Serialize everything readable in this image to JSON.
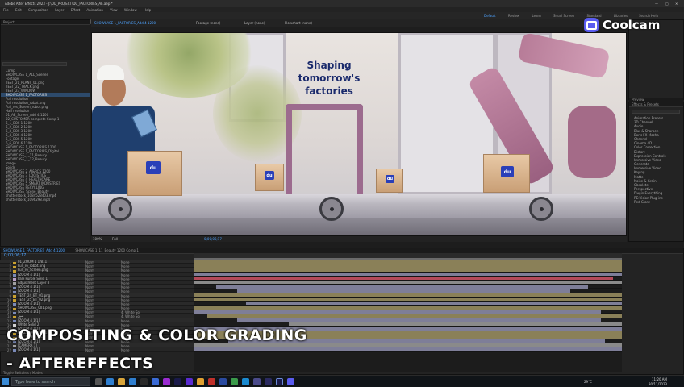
{
  "app": {
    "title": "Adobe After Effects 2023 - J:\\DU_PROJECT\\DU_FACTORIES_AE.aep *",
    "menu": [
      "File",
      "Edit",
      "Composition",
      "Layer",
      "Effect",
      "Animation",
      "View",
      "Window",
      "Help"
    ],
    "workspaces": [
      "Default",
      "Review",
      "Learn",
      "Small Screen",
      "Standard",
      "Libraries"
    ],
    "active_workspace": "Default",
    "search_label": "Search Help"
  },
  "watermark": {
    "brand": "Coolcam"
  },
  "captions": {
    "line1": "COMPOSITING & COLOR GRADING",
    "line2": "- AFTEREFFECTS"
  },
  "project_panel": {
    "tab": "Project",
    "items": [
      "Comp",
      "SHOWCASE 1_ALL_Scenes",
      "Footage",
      "TEST_21_PLANT_01.png",
      "TEST_22_TRACK.png",
      "TEST_23_WINDOW",
      "SHOWCASE 1_FACTORIES",
      "Full resolution",
      "Full resolution_robot.png",
      "Full_res_Screen_robot.png",
      "Half resolution",
      "01_AE_Screen_Add 4 1200",
      "02_CUSTOMER complete Comp 1",
      "6_1_BOX 1 1200",
      "6_2_BOX 2 1200",
      "6_3_BOX 3 1200",
      "6_4_BOX 4 1200",
      "6_5_BOX 5 1200",
      "6_6_BOX 6 1200",
      "SHOWCASE 1_FACTORIES 1200",
      "SHOWCASE 1_FACTORIES_Digital",
      "SHOWCASE_1_11_Beauty",
      "SHOWCASE_1_12_Beauty",
      "Image",
      "Solids",
      "SHOWCASE 2_AI&RCS 1200",
      "SHOWCASE 3_LOGISTICS",
      "SHOWCASE 4_HEALTHCARE",
      "SHOWCASE 5_SMART INDUSTRIES",
      "SHOWCASE RECYCLING",
      "SHOWCASE_Scene_Beauty",
      "shutterstock_1084528403.mp4",
      "shutterstock_1096298.mp4"
    ],
    "selected_index": 6
  },
  "composition_tabs": {
    "active": "SHOWCASE 1_FACTORIES_Add 4 1200",
    "others": [
      "Footage (none)",
      "Layer (none)",
      "Flowchart (none)"
    ]
  },
  "viewer": {
    "headline_line1": "Shaping",
    "headline_line2": "tomorrow's factories",
    "box_logo": "du",
    "zoom": "100%",
    "resolution": "Full",
    "timecode": "0;00;06;17"
  },
  "right_panels": {
    "preview_tab": "Preview",
    "effects_tab": "Effects & Presets",
    "effects": [
      "Animation Presets",
      "3D Channel",
      "Audio",
      "Blur & Sharpen",
      "Boris FX Mocha",
      "Channel",
      "Cinema 4D",
      "Color Correction",
      "Distort",
      "Expression Controls",
      "Immersive Video",
      "Generate",
      "Immersive Video",
      "Keying",
      "Matte",
      "Noise & Grain",
      "Obsolete",
      "Perspective",
      "Plugin Everything",
      "RE:Vision Plug-ins",
      "Red Giant"
    ]
  },
  "timeline": {
    "tabs": [
      "SHOWCASE 1_FACTORIES_Add 4 1200",
      "SHOWCASE 1_11_Beauty 1200 Comp 1"
    ],
    "current_time": "0;00;06;17",
    "columns": [
      "#",
      "Source Name",
      "Mode",
      "Track Matte",
      "Parent & Link"
    ],
    "layers": [
      {
        "num": "1",
        "name": "01_ZOOM 1 1/811",
        "color": "#c8a030",
        "mode": "Norm",
        "parent": "None"
      },
      {
        "num": "2",
        "name": "Full_ro_robot.png",
        "color": "#c8a030",
        "mode": "Norm",
        "parent": "None"
      },
      {
        "num": "3",
        "name": "Full_ro_Screen.png",
        "color": "#c8a030",
        "mode": "Norm",
        "parent": "None"
      },
      {
        "num": "4",
        "name": "[ZOOM 4 1/1]",
        "color": "#7a8ab8",
        "mode": "Norm",
        "parent": "None"
      },
      {
        "num": "5",
        "name": "Pale Purple Solid 1",
        "color": "#b8a0c8",
        "mode": "Norm",
        "parent": "None"
      },
      {
        "num": "6",
        "name": "Adjustment Layer 8",
        "color": "#a0a0a0",
        "mode": "Norm",
        "parent": "None"
      },
      {
        "num": "7",
        "name": "[ZOOM 4 1/1]",
        "color": "#7a8ab8",
        "mode": "Norm",
        "parent": "None"
      },
      {
        "num": "8",
        "name": "[ZOOM 4 1/1]",
        "color": "#7a8ab8",
        "mode": "Norm",
        "parent": "None"
      },
      {
        "num": "9",
        "name": "TEST_24_BT_01.png",
        "color": "#c8a030",
        "mode": "Norm",
        "parent": "None"
      },
      {
        "num": "10",
        "name": "TEST_25_BT_02.png",
        "color": "#c8a030",
        "mode": "Norm",
        "parent": "None"
      },
      {
        "num": "11",
        "name": "[ZOOM 4 1/1]",
        "color": "#7a8ab8",
        "mode": "Norm",
        "parent": "None"
      },
      {
        "num": "12",
        "name": "SHOWCASE_001.png",
        "color": "#c8a030",
        "mode": "Norm",
        "parent": "None"
      },
      {
        "num": "13",
        "name": "[ZOOM 4 1/1]",
        "color": "#7a8ab8",
        "mode": "Norm",
        "parent": "4. White Sol"
      },
      {
        "num": "14",
        "name": "صور",
        "color": "#c8a030",
        "mode": "Norm",
        "parent": "4. White Sol"
      },
      {
        "num": "15",
        "name": "[ZOOM 4 1/1]",
        "color": "#7a8ab8",
        "mode": "Norm",
        "parent": "None"
      },
      {
        "num": "16",
        "name": "White Solid 2",
        "color": "#d0d0d0",
        "mode": "Norm",
        "parent": "None"
      },
      {
        "num": "17",
        "name": "[ZOOM 4 1/1]",
        "color": "#7a8ab8",
        "mode": "Norm",
        "parent": "None"
      },
      {
        "num": "18",
        "name": "01_ZOOM 4 1/811",
        "color": "#c8a030",
        "mode": "Norm",
        "parent": "None"
      },
      {
        "num": "19",
        "name": "RE1_ROBOT_ALL",
        "color": "#c8a030",
        "mode": "Norm",
        "parent": "None"
      },
      {
        "num": "20",
        "name": "[ZOOM 4 1/1]",
        "color": "#7a8ab8",
        "mode": "Norm",
        "parent": "None"
      },
      {
        "num": "21",
        "name": "[CAMERA 1]",
        "color": "#a0a0a0",
        "mode": "Norm",
        "parent": "None"
      },
      {
        "num": "22",
        "name": "[ZOOM 4 1/1]",
        "color": "#7a8ab8",
        "mode": "Norm",
        "parent": "None"
      }
    ],
    "footer_label": "Toggle Switches / Modes"
  },
  "taskbar": {
    "search_placeholder": "Type here to search",
    "temperature": "29°C",
    "time": "11:20 AM",
    "date": "30/11/2023"
  }
}
